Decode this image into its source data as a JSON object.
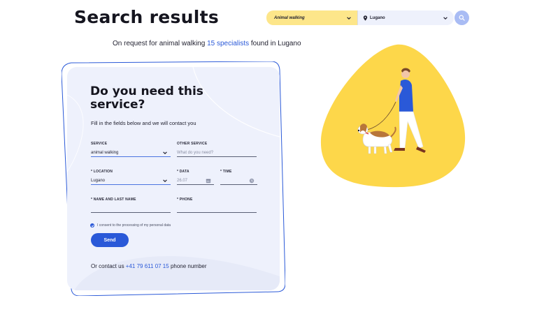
{
  "header": {
    "title": "Search results"
  },
  "search": {
    "service_value": "Animal walking",
    "location_value": "Lugano"
  },
  "summary": {
    "prefix": "On request for animal walking ",
    "count": "15 specialists",
    "suffix": " found in Lugano"
  },
  "form": {
    "title": "Do you need this service?",
    "subtitle": "Fill in the fields below and we will contact you",
    "service": {
      "label": "SERVICE",
      "value": "animal walking"
    },
    "other_service": {
      "label": "OTHER SERVICE",
      "placeholder": "What do you need?"
    },
    "location": {
      "label": "* LOCATION",
      "value": "Lugano"
    },
    "date": {
      "label": "* DATA",
      "value": "26.07"
    },
    "time": {
      "label": "* TIME",
      "value": ""
    },
    "name": {
      "label": "* NAME AND LAST NAME",
      "value": ""
    },
    "phone": {
      "label": "* PHONE",
      "value": ""
    },
    "consent": "I consent to the processing of my personal data",
    "consent_checked": true,
    "send_label": "Send",
    "contact_prefix": "Or contact us ",
    "contact_phone": "+41 79 611 07 15",
    "contact_suffix": " phone number"
  },
  "colors": {
    "accent": "#2a59d8",
    "yellow": "#fdd74a",
    "card_bg": "#eef1fc"
  },
  "icons": [
    "chevron-down-icon",
    "location-pin-icon",
    "search-icon",
    "calendar-icon",
    "clock-icon",
    "check-icon"
  ]
}
